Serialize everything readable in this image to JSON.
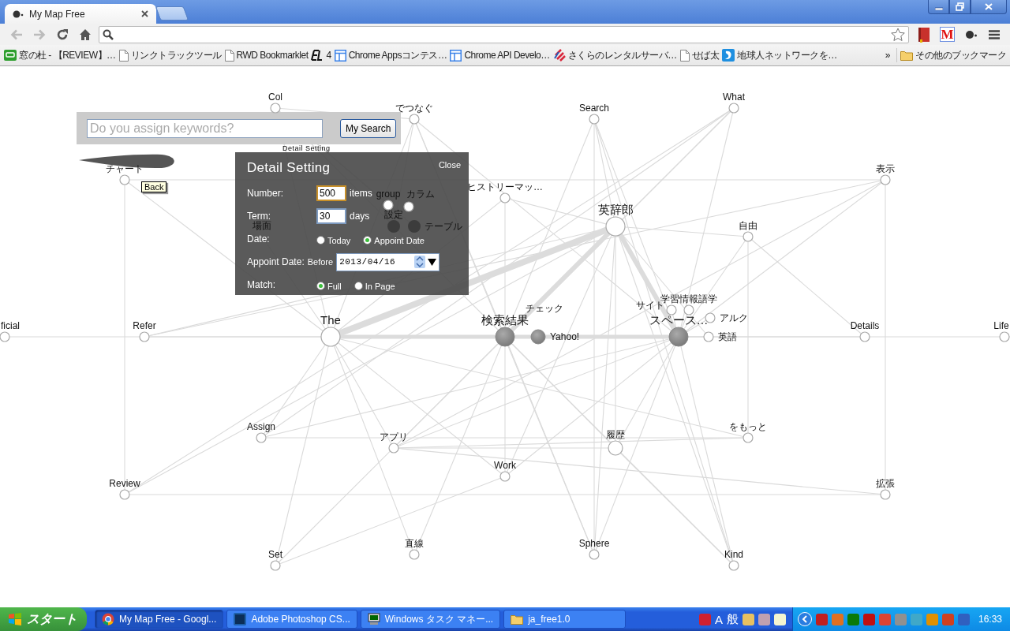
{
  "browser": {
    "tab_title": "My Map Free",
    "extensions": [
      {
        "kind": "book"
      },
      {
        "kind": "letter",
        "label": "M"
      },
      {
        "kind": "dot"
      }
    ],
    "bookmarks": [
      {
        "kind": "app",
        "label": "窓の杜 - 【REVIEW】…"
      },
      {
        "kind": "page",
        "label": "リンクトラックツール"
      },
      {
        "kind": "page",
        "label": "RWD Bookmarklet"
      },
      {
        "kind": "logo",
        "label": "4"
      },
      {
        "kind": "webapp",
        "label": "Chrome Appsコンテス…"
      },
      {
        "kind": "webapp",
        "label": "Chrome API Develo…"
      },
      {
        "kind": "slash",
        "label": "さくらのレンタルサーバ…"
      },
      {
        "kind": "page",
        "label": "せば太"
      },
      {
        "kind": "globe",
        "label": "地球人ネットワークを…"
      }
    ],
    "more": "»",
    "other_bookmarks": "その他のブックマーク"
  },
  "map": {
    "search": {
      "placeholder": "Do you assign keywords?",
      "button": "My Search",
      "detail_link": "Detail Setting"
    },
    "tooltip": "Back",
    "nodes": [
      {
        "label": "Col",
        "kind": "node"
      },
      {
        "label": "What",
        "kind": "node"
      },
      {
        "label": "でつなぐ",
        "kind": "node"
      },
      {
        "label": "Search",
        "kind": "node"
      },
      {
        "label": "表示",
        "kind": "node"
      },
      {
        "label": "チャート",
        "kind": "node"
      },
      {
        "label": "ヒストリーマッ…",
        "kind": "node"
      },
      {
        "label": "group",
        "kind": "node"
      },
      {
        "label": "カラム",
        "kind": "node"
      },
      {
        "label": "英辞郎",
        "kind": "hub"
      },
      {
        "label": "設定",
        "kind": "dark"
      },
      {
        "label": "場面",
        "kind": "bare"
      },
      {
        "label": "テーブル",
        "kind": "dark"
      },
      {
        "label": "自由",
        "kind": "node"
      },
      {
        "label": "学習情報語学",
        "kind": "node"
      },
      {
        "label": "チェック",
        "kind": "bare"
      },
      {
        "label": "サイト",
        "kind": "node"
      },
      {
        "label": "アルク",
        "kind": "node"
      },
      {
        "label": "ficial",
        "kind": "node"
      },
      {
        "label": "Refer",
        "kind": "node"
      },
      {
        "label": "The",
        "kind": "hub"
      },
      {
        "label": "検索結果",
        "kind": "topic"
      },
      {
        "label": "Yahoo!",
        "kind": "link"
      },
      {
        "label": "スペース…",
        "kind": "topic"
      },
      {
        "label": "英語",
        "kind": "node"
      },
      {
        "label": "Details",
        "kind": "node"
      },
      {
        "label": "Life",
        "kind": "node"
      },
      {
        "label": "Assign",
        "kind": "node"
      },
      {
        "label": "アプリ",
        "kind": "node"
      },
      {
        "label": "履歴",
        "kind": "minor"
      },
      {
        "label": "をもっと",
        "kind": "node"
      },
      {
        "label": "Work",
        "kind": "node"
      },
      {
        "label": "Review",
        "kind": "node"
      },
      {
        "label": "拡張",
        "kind": "node"
      },
      {
        "label": "直線",
        "kind": "node"
      },
      {
        "label": "Sphere",
        "kind": "node"
      },
      {
        "label": "Set",
        "kind": "node"
      },
      {
        "label": "Kind",
        "kind": "node"
      }
    ],
    "panel": {
      "title": "Detail Setting",
      "close": "Close",
      "number": {
        "label": "Number:",
        "value": "500",
        "unit": "items",
        "focused": true
      },
      "term": {
        "label": "Term:",
        "value": "30",
        "unit": "days",
        "focused": false
      },
      "date": {
        "label": "Date:",
        "options": [
          {
            "label": "Today",
            "selected": false
          },
          {
            "label": "Appoint Date",
            "selected": true
          }
        ]
      },
      "appoint": {
        "label": "Appoint Date:",
        "prefix": "Before",
        "value": "2013/04/16"
      },
      "match": {
        "label": "Match:",
        "options": [
          {
            "label": "Full",
            "selected": true
          },
          {
            "label": "In Page",
            "selected": false
          }
        ]
      }
    }
  },
  "taskbar": {
    "start": "スタート",
    "tasks": [
      {
        "kind": "chrome",
        "label": "My Map Free - Googl...",
        "selected": true
      },
      {
        "kind": "photoshop",
        "label": "Adobe Photoshop CS...",
        "selected": false
      },
      {
        "kind": "monitor",
        "label": "Windows タスク マネー...",
        "selected": false
      },
      {
        "kind": "folder",
        "label": "ja_free1.0",
        "selected": false
      }
    ],
    "ime": [
      "A",
      "般"
    ],
    "clock": "16:33"
  }
}
